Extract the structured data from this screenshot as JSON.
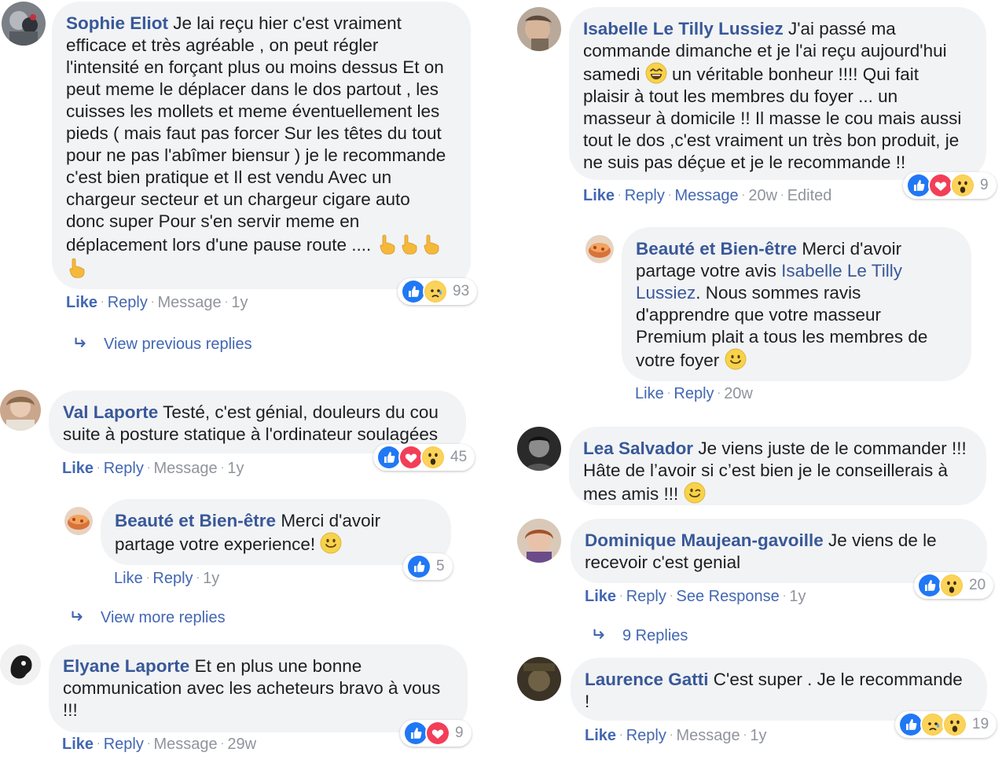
{
  "comments": {
    "sophie": {
      "name": "Sophie Eliot",
      "lines": [
        " Je lai reçu hier c'est vraiment",
        "efficace et très agréable , on peut régler",
        "l'intensité en forçant plus ou moins dessus Et on",
        "peut meme le déplacer dans le dos partout , les",
        "cuisses les mollets et meme éventuellement les",
        "pieds ( mais faut pas forcer Sur les têtes du tout",
        "pour ne pas l'abîmer biensur ) je le recommande",
        "c'est bien pratique et Il est vendu Avec un",
        "chargeur secteur et un chargeur cigare auto",
        "donc super Pour s'en servir meme en",
        "déplacement lors d'une pause route .... "
      ],
      "like": "Like",
      "reply": "Reply",
      "message": "Message",
      "time": "1y",
      "reaction_count": "93",
      "view_previous": "View previous replies"
    },
    "val": {
      "name": "Val Laporte",
      "lines": [
        " Testé, c'est génial, douleurs du cou",
        "suite à posture statique à l'ordinateur soulagées"
      ],
      "like": "Like",
      "reply": "Reply",
      "message": "Message",
      "time": "1y",
      "reaction_count": "45"
    },
    "beaute1": {
      "name": "Beauté et Bien-être",
      "lines": [
        " Merci d'avoir",
        "partage votre experience! "
      ],
      "like": "Like",
      "reply": "Reply",
      "time": "1y",
      "reaction_count": "5",
      "view_more": "View more replies"
    },
    "elyane": {
      "name": "Elyane Laporte",
      "lines": [
        " Et en plus une bonne",
        "communication avec les acheteurs bravo à vous",
        "!!!"
      ],
      "like": "Like",
      "reply": "Reply",
      "message": "Message",
      "time": "29w",
      "reaction_count": "9"
    },
    "isabelle": {
      "name": "Isabelle Le Tilly Lussiez",
      "lines": [
        " J'ai passé ma",
        "commande dimanche et je l'ai reçu aujourd'hui",
        "samedi ",
        " un véritable bonheur !!!! Qui fait",
        "plaisir à tout les membres du foyer ... un",
        "masseur à domicile !! Il masse le cou mais aussi",
        "tout le dos ,c'est vraiment un très bon produit, je",
        "ne suis pas déçue et je le recommande !!"
      ],
      "like": "Like",
      "reply": "Reply",
      "message": "Message",
      "time": "20w",
      "edited": "Edited",
      "reaction_count": "9"
    },
    "beaute2": {
      "name": "Beauté et Bien-être",
      "line1": " Merci d'avoir",
      "line2a": "partage votre avis ",
      "mention_a": "Isabelle Le Tilly",
      "mention_b": "Lussiez",
      "line3": ". Nous sommes ravis",
      "line4": "d'apprendre que votre masseur",
      "line5": "Premium plait a tous les membres de",
      "line6": "votre foyer ",
      "like": "Like",
      "reply": "Reply",
      "time": "20w"
    },
    "lea": {
      "name": "Lea Salvador",
      "lines": [
        " Je viens juste de le commander !!!",
        "Hâte de l’avoir si c’est bien je le conseillerais à",
        "mes amis !!! "
      ]
    },
    "dominique": {
      "name": "Dominique Maujean-gavoille",
      "lines": [
        " Je viens de le",
        "recevoir c'est genial"
      ],
      "like": "Like",
      "reply": "Reply",
      "see_response": "See Response",
      "time": "1y",
      "reaction_count": "20",
      "replies": "9 Replies"
    },
    "laurence": {
      "name": "Laurence Gatti",
      "lines": [
        " C'est super . Je le recommande",
        "!"
      ],
      "like": "Like",
      "reply": "Reply",
      "message": "Message",
      "time": "1y",
      "reaction_count": "19"
    }
  },
  "colors": {
    "name_blue": "#385898",
    "action_blue": "#4267b2",
    "bubble_bg": "#f2f3f5",
    "muted": "#90949c"
  }
}
